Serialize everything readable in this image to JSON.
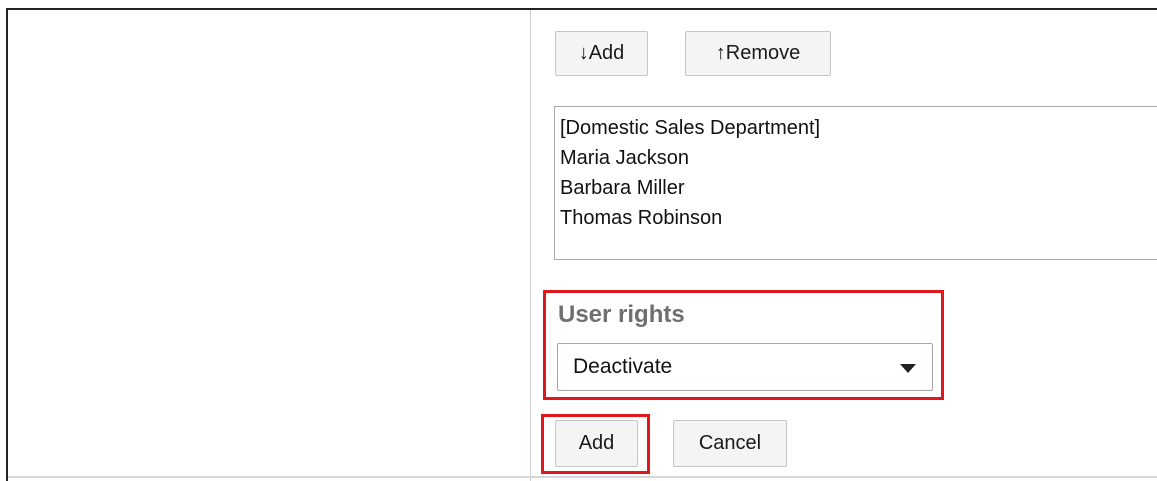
{
  "members": {
    "add_label": "↓Add",
    "remove_label": "↑Remove",
    "items": [
      "[Domestic Sales Department]",
      "Maria Jackson",
      "Barbara Miller",
      "Thomas Robinson"
    ]
  },
  "user_rights": {
    "label": "User rights",
    "selected": "Deactivate"
  },
  "actions": {
    "submit_label": "Add",
    "cancel_label": "Cancel"
  },
  "colors": {
    "highlight": "#e1171e",
    "label_gray": "#6f6f6f"
  },
  "icons": {
    "dropdown": "chevron-down-icon"
  }
}
